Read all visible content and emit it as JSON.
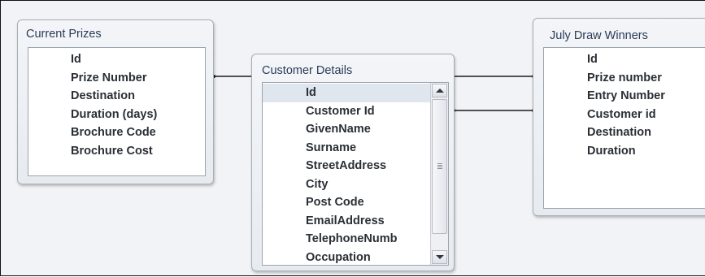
{
  "tables": {
    "current_prizes": {
      "title": "Current Prizes",
      "fields": [
        "Id",
        "Prize Number",
        "Destination",
        "Duration (days)",
        "Brochure Code",
        "Brochure Cost"
      ]
    },
    "customer_details": {
      "title": "Customer Details",
      "fields": [
        "Id",
        "Customer Id",
        "GivenName",
        "Surname",
        "StreetAddress",
        "City",
        "Post Code",
        "EmailAddress",
        "TelephoneNumb",
        "Occupation"
      ],
      "selected_field": "Id"
    },
    "july_draw_winners": {
      "title": "July Draw Winners",
      "fields": [
        "Id",
        "Prize number",
        "Entry Number",
        "Customer id",
        "Destination",
        "Duration"
      ]
    }
  },
  "colors": {
    "canvas": "#f1f3f6",
    "window_border": "#a7aeb7",
    "title_text": "#2b3c58",
    "field_text": "#2a2f35",
    "relationship_line": "#1a1a1a"
  },
  "icons": {
    "scroll_up": "arrow-up-icon",
    "scroll_down": "arrow-down-icon"
  }
}
